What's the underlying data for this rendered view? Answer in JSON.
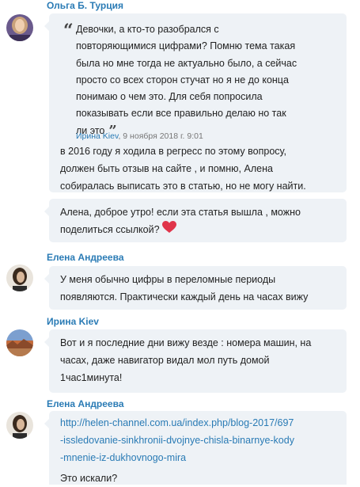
{
  "posts": [
    {
      "author": "Ольга Б. Турция",
      "quote": {
        "lines": [
          "Девочки, а кто-то разобрался с",
          "повторяющимися цифрами? Помню тема такая",
          "была но мне тогда не актуально было, а сейчас",
          "просто со всех сторон стучат но я не до конца",
          "понимаю о чем это. Для себя попросила",
          "показывать если все правильно делаю но так",
          "ли это"
        ],
        "cite_author": "Ирина Kiev",
        "cite_date": ", 9 ноября 2018 г. 9:01"
      },
      "reply_lines": [
        "в 2016 году я ходила в регресс по этому вопросу,",
        "должен быть отзыв на сайте , и помню, Алена",
        "собиралась выписать это в статью, но не могу найти."
      ],
      "second_message_lines": [
        "Алена, доброе утро! если эта статья вышла , можно",
        "поделиться ссылкой?"
      ]
    },
    {
      "author": "Елена Андреева",
      "lines": [
        "У меня обычно цифры в переломные периоды",
        "появляются. Практически каждый день на часах вижу"
      ]
    },
    {
      "author": "Ирина Kiev",
      "lines": [
        "Вот и я последние дни вижу везде : номера машин, на",
        "часах, даже навигатор видал мол путь домой",
        "1час1минута!"
      ]
    },
    {
      "author": "Елена Андреева",
      "link_lines": [
        "http://helen-channel.com.ua/index.php/blog-2017/697",
        "-issledovanie-sinkhronii-dvojnye-chisla-binarnye-kody",
        "-mnenie-iz-dukhovnogo-mira"
      ],
      "after_link": "Это искали?"
    }
  ],
  "colors": {
    "author": "#2a7bb5",
    "bubble": "#eef2f6",
    "heart": "#e0344a"
  },
  "icons": {
    "heart": "heart-icon",
    "open_quote": "open-quote-icon",
    "close_quote": "close-quote-icon"
  }
}
